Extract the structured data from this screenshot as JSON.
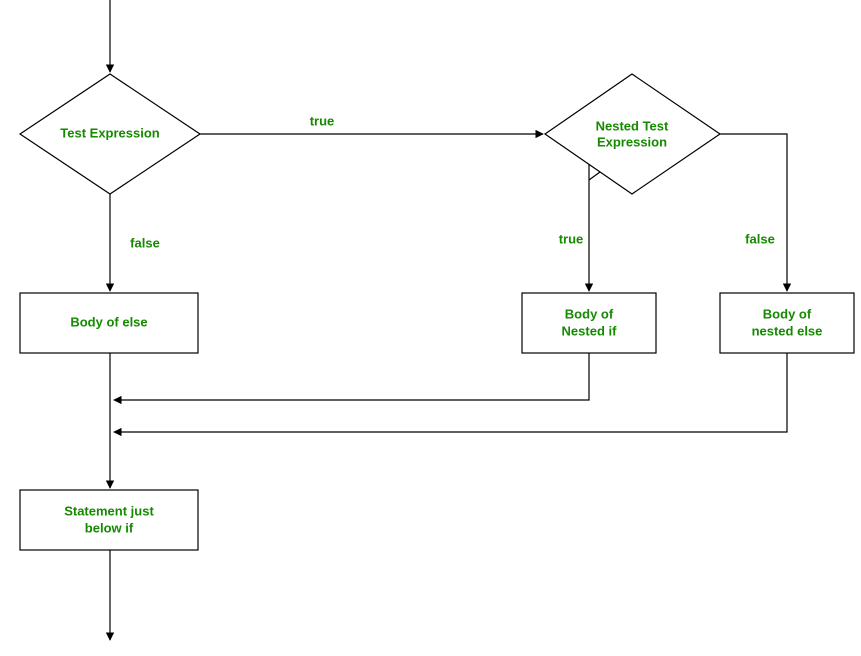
{
  "diagram": {
    "nodes": {
      "test_expression": "Test Expression",
      "nested_test_expression_l1": "Nested Test",
      "nested_test_expression_l2": "Expression",
      "body_of_else": "Body of else",
      "body_of_nested_if_l1": "Body of",
      "body_of_nested_if_l2": "Nested if",
      "body_of_nested_else_l1": "Body of",
      "body_of_nested_else_l2": "nested else",
      "statement_below_if_l1": "Statement just",
      "statement_below_if_l2": "below if"
    },
    "edges": {
      "true1": "true",
      "false1": "false",
      "true2": "true",
      "false2": "false"
    }
  }
}
